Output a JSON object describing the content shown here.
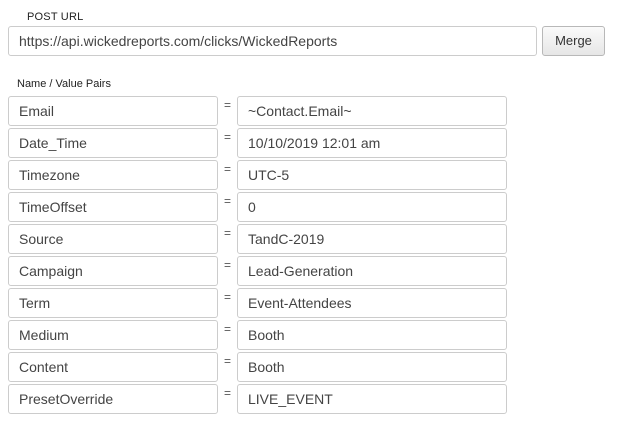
{
  "post_url": {
    "label": "POST URL",
    "value": "https://api.wickedreports.com/clicks/WickedReports",
    "merge_label": "Merge"
  },
  "pairs": {
    "label": "Name / Value Pairs",
    "separator": "=",
    "rows": [
      {
        "name": "Email",
        "value": "~Contact.Email~"
      },
      {
        "name": "Date_Time",
        "value": "10/10/2019 12:01 am"
      },
      {
        "name": "Timezone",
        "value": "UTC-5"
      },
      {
        "name": "TimeOffset",
        "value": "0"
      },
      {
        "name": "Source",
        "value": "TandC-2019"
      },
      {
        "name": "Campaign",
        "value": "Lead-Generation"
      },
      {
        "name": "Term",
        "value": "Event-Attendees"
      },
      {
        "name": "Medium",
        "value": "Booth"
      },
      {
        "name": "Content",
        "value": "Booth"
      },
      {
        "name": "PresetOverride",
        "value": "LIVE_EVENT"
      }
    ]
  }
}
